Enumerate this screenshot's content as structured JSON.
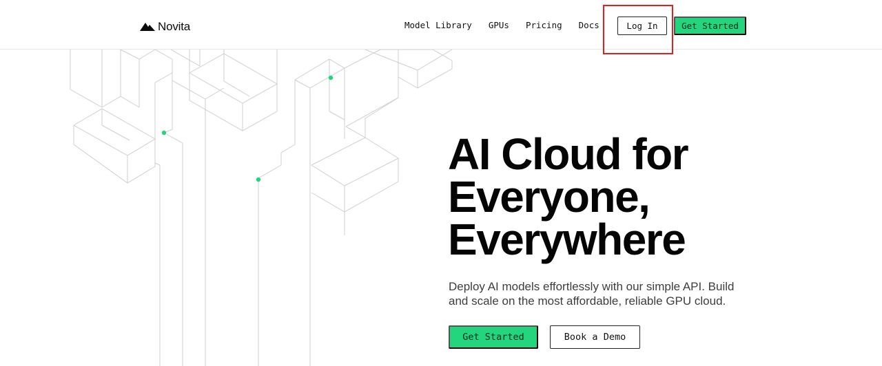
{
  "header": {
    "brand": {
      "name": "Novita",
      "logo_icon": "novita-mountain-logo"
    },
    "nav": [
      {
        "id": "model-library",
        "label": "Model Library"
      },
      {
        "id": "gpus",
        "label": "GPUs"
      },
      {
        "id": "pricing",
        "label": "Pricing"
      },
      {
        "id": "docs",
        "label": "Docs"
      }
    ],
    "login_label": "Log In",
    "get_started_label": "Get Started"
  },
  "hero": {
    "title_lines": [
      "AI Cloud for",
      "Everyone,",
      "Everywhere"
    ],
    "subtitle": "Deploy AI models effortlessly with our simple API. Build and scale on the most affordable, reliable GPU cloud.",
    "primary_cta": "Get Started",
    "secondary_cta": "Book a Demo"
  },
  "colors": {
    "accent": "#23d57c",
    "highlight_box": "#e02020",
    "line": "#cfcfcf"
  }
}
